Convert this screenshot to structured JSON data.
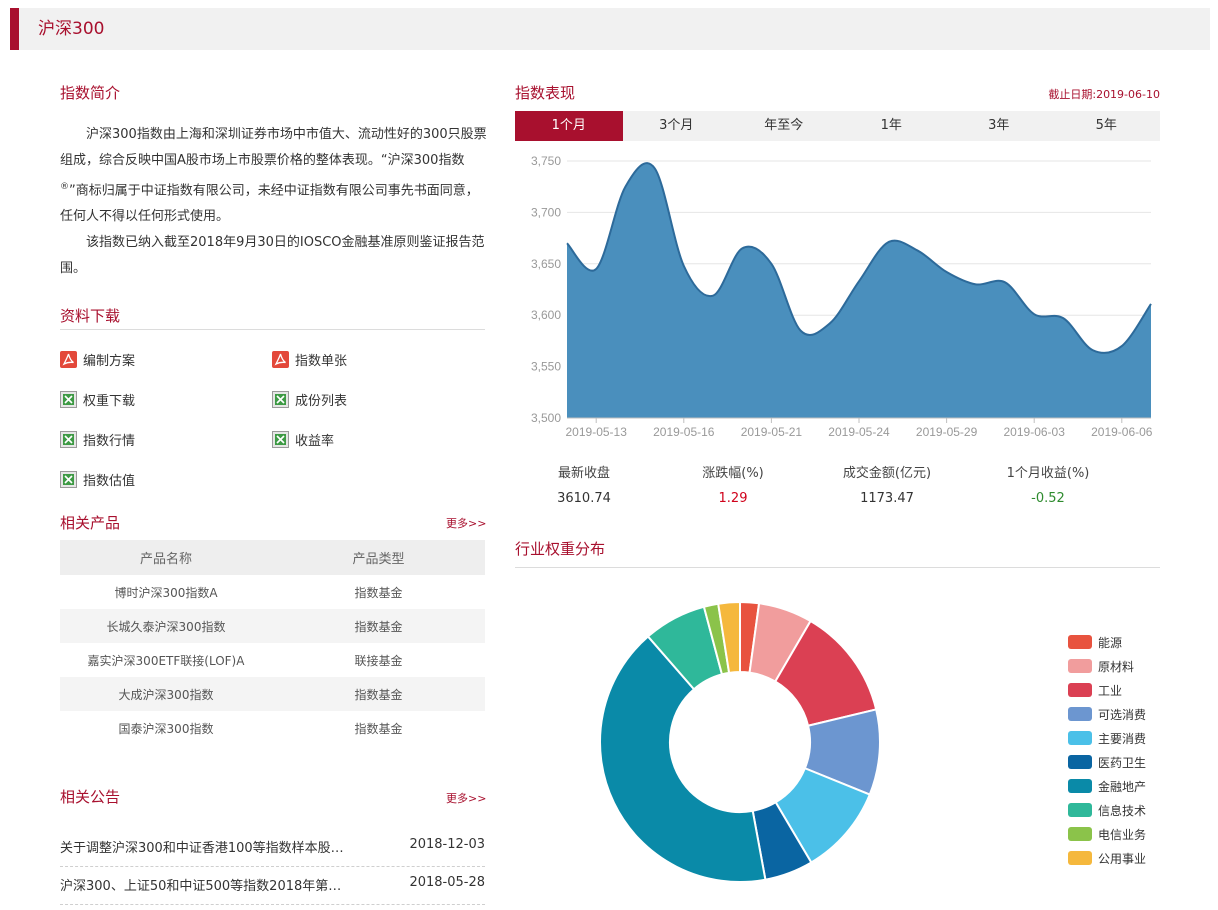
{
  "header": {
    "title": "沪深300"
  },
  "intro": {
    "title": "指数简介",
    "para1": "沪深300指数由上海和深圳证券市场中市值大、流动性好的300只股票组成，综合反映中国A股市场上市股票价格的整体表现。“沪深300指数",
    "reg_mark": "®",
    "para1_tail": "”商标归属于中证指数有限公司，未经中证指数有限公司事先书面同意，任何人不得以任何形式使用。",
    "para2": "该指数已纳入截至2018年9月30日的IOSCO金融基准原则鉴证报告范围。"
  },
  "downloads": {
    "title": "资料下载",
    "items": [
      {
        "label": "编制方案",
        "icon": "pdf-icon"
      },
      {
        "label": "指数单张",
        "icon": "pdf-icon"
      },
      {
        "label": "权重下载",
        "icon": "excel-icon"
      },
      {
        "label": "成份列表",
        "icon": "excel-icon"
      },
      {
        "label": "指数行情",
        "icon": "excel-icon"
      },
      {
        "label": "收益率",
        "icon": "excel-icon"
      },
      {
        "label": "指数估值",
        "icon": "excel-icon"
      }
    ]
  },
  "products": {
    "title": "相关产品",
    "more": "更多>>",
    "headers": [
      "产品名称",
      "产品类型"
    ],
    "rows": [
      [
        "博时沪深300指数A",
        "指数基金"
      ],
      [
        "长城久泰沪深300指数",
        "指数基金"
      ],
      [
        "嘉实沪深300ETF联接(LOF)A",
        "联接基金"
      ],
      [
        "大成沪深300指数",
        "指数基金"
      ],
      [
        "国泰沪深300指数",
        "指数基金"
      ]
    ]
  },
  "notices": {
    "title": "相关公告",
    "more": "更多>>",
    "items": [
      {
        "title": "关于调整沪深300和中证香港100等指数样本股…",
        "date": "2018-12-03"
      },
      {
        "title": "沪深300、上证50和中证500等指数2018年第…",
        "date": "2018-05-28"
      }
    ]
  },
  "performance": {
    "title": "指数表现",
    "as_of": "截止日期:2019-06-10",
    "tabs": [
      "1个月",
      "3个月",
      "年至今",
      "1年",
      "3年",
      "5年"
    ],
    "active_tab": 0,
    "stats": [
      {
        "label": "最新收盘",
        "value": "3610.74",
        "color": "#333333"
      },
      {
        "label": "涨跌幅(%)",
        "value": "1.29",
        "color": "#d0021b"
      },
      {
        "label": "成交金额(亿元)",
        "value": "1173.47",
        "color": "#333333"
      },
      {
        "label": "1个月收益(%)",
        "value": "-0.52",
        "color": "#2e8b2e"
      }
    ]
  },
  "industry": {
    "title": "行业权重分布"
  },
  "colors": {
    "brand": "#a8102e",
    "area_fill": "#4a8fbd",
    "area_line": "#2d6a9a"
  },
  "chart_data": [
    {
      "type": "area",
      "x": [
        "2019-05-10",
        "2019-05-13",
        "2019-05-14",
        "2019-05-15",
        "2019-05-16",
        "2019-05-17",
        "2019-05-20",
        "2019-05-21",
        "2019-05-22",
        "2019-05-23",
        "2019-05-24",
        "2019-05-27",
        "2019-05-28",
        "2019-05-29",
        "2019-05-30",
        "2019-05-31",
        "2019-06-03",
        "2019-06-04",
        "2019-06-05",
        "2019-06-06",
        "2019-06-10"
      ],
      "x_tick_labels": [
        "2019-05-13",
        "2019-05-16",
        "2019-05-21",
        "2019-05-24",
        "2019-05-29",
        "2019-06-03",
        "2019-06-06"
      ],
      "series": [
        {
          "values": [
            3670,
            3645,
            3725,
            3743,
            3648,
            3619,
            3665,
            3650,
            3585,
            3592,
            3633,
            3671,
            3663,
            3642,
            3630,
            3632,
            3601,
            3597,
            3566,
            3570,
            3611
          ]
        }
      ],
      "ylim": [
        3500,
        3750
      ],
      "y_ticks": [
        "3,500",
        "3,550",
        "3,600",
        "3,650",
        "3,700",
        "3,750"
      ],
      "grid": true
    },
    {
      "type": "pie",
      "donut": true,
      "labels": [
        "能源",
        "原材料",
        "工业",
        "可选消费",
        "主要消费",
        "医药卫生",
        "金融地产",
        "信息技术",
        "电信业务",
        "公用事业"
      ],
      "values": [
        2.1,
        6.0,
        12.4,
        9.5,
        10.0,
        5.4,
        40.0,
        7.0,
        1.6,
        2.4
      ],
      "colors": [
        "#e8533f",
        "#f19d9d",
        "#db4053",
        "#6c96d0",
        "#4bc0e8",
        "#0a65a2",
        "#0a8aa8",
        "#2fb89a",
        "#8bc34a",
        "#f5b83d"
      ],
      "legend": "right"
    }
  ]
}
